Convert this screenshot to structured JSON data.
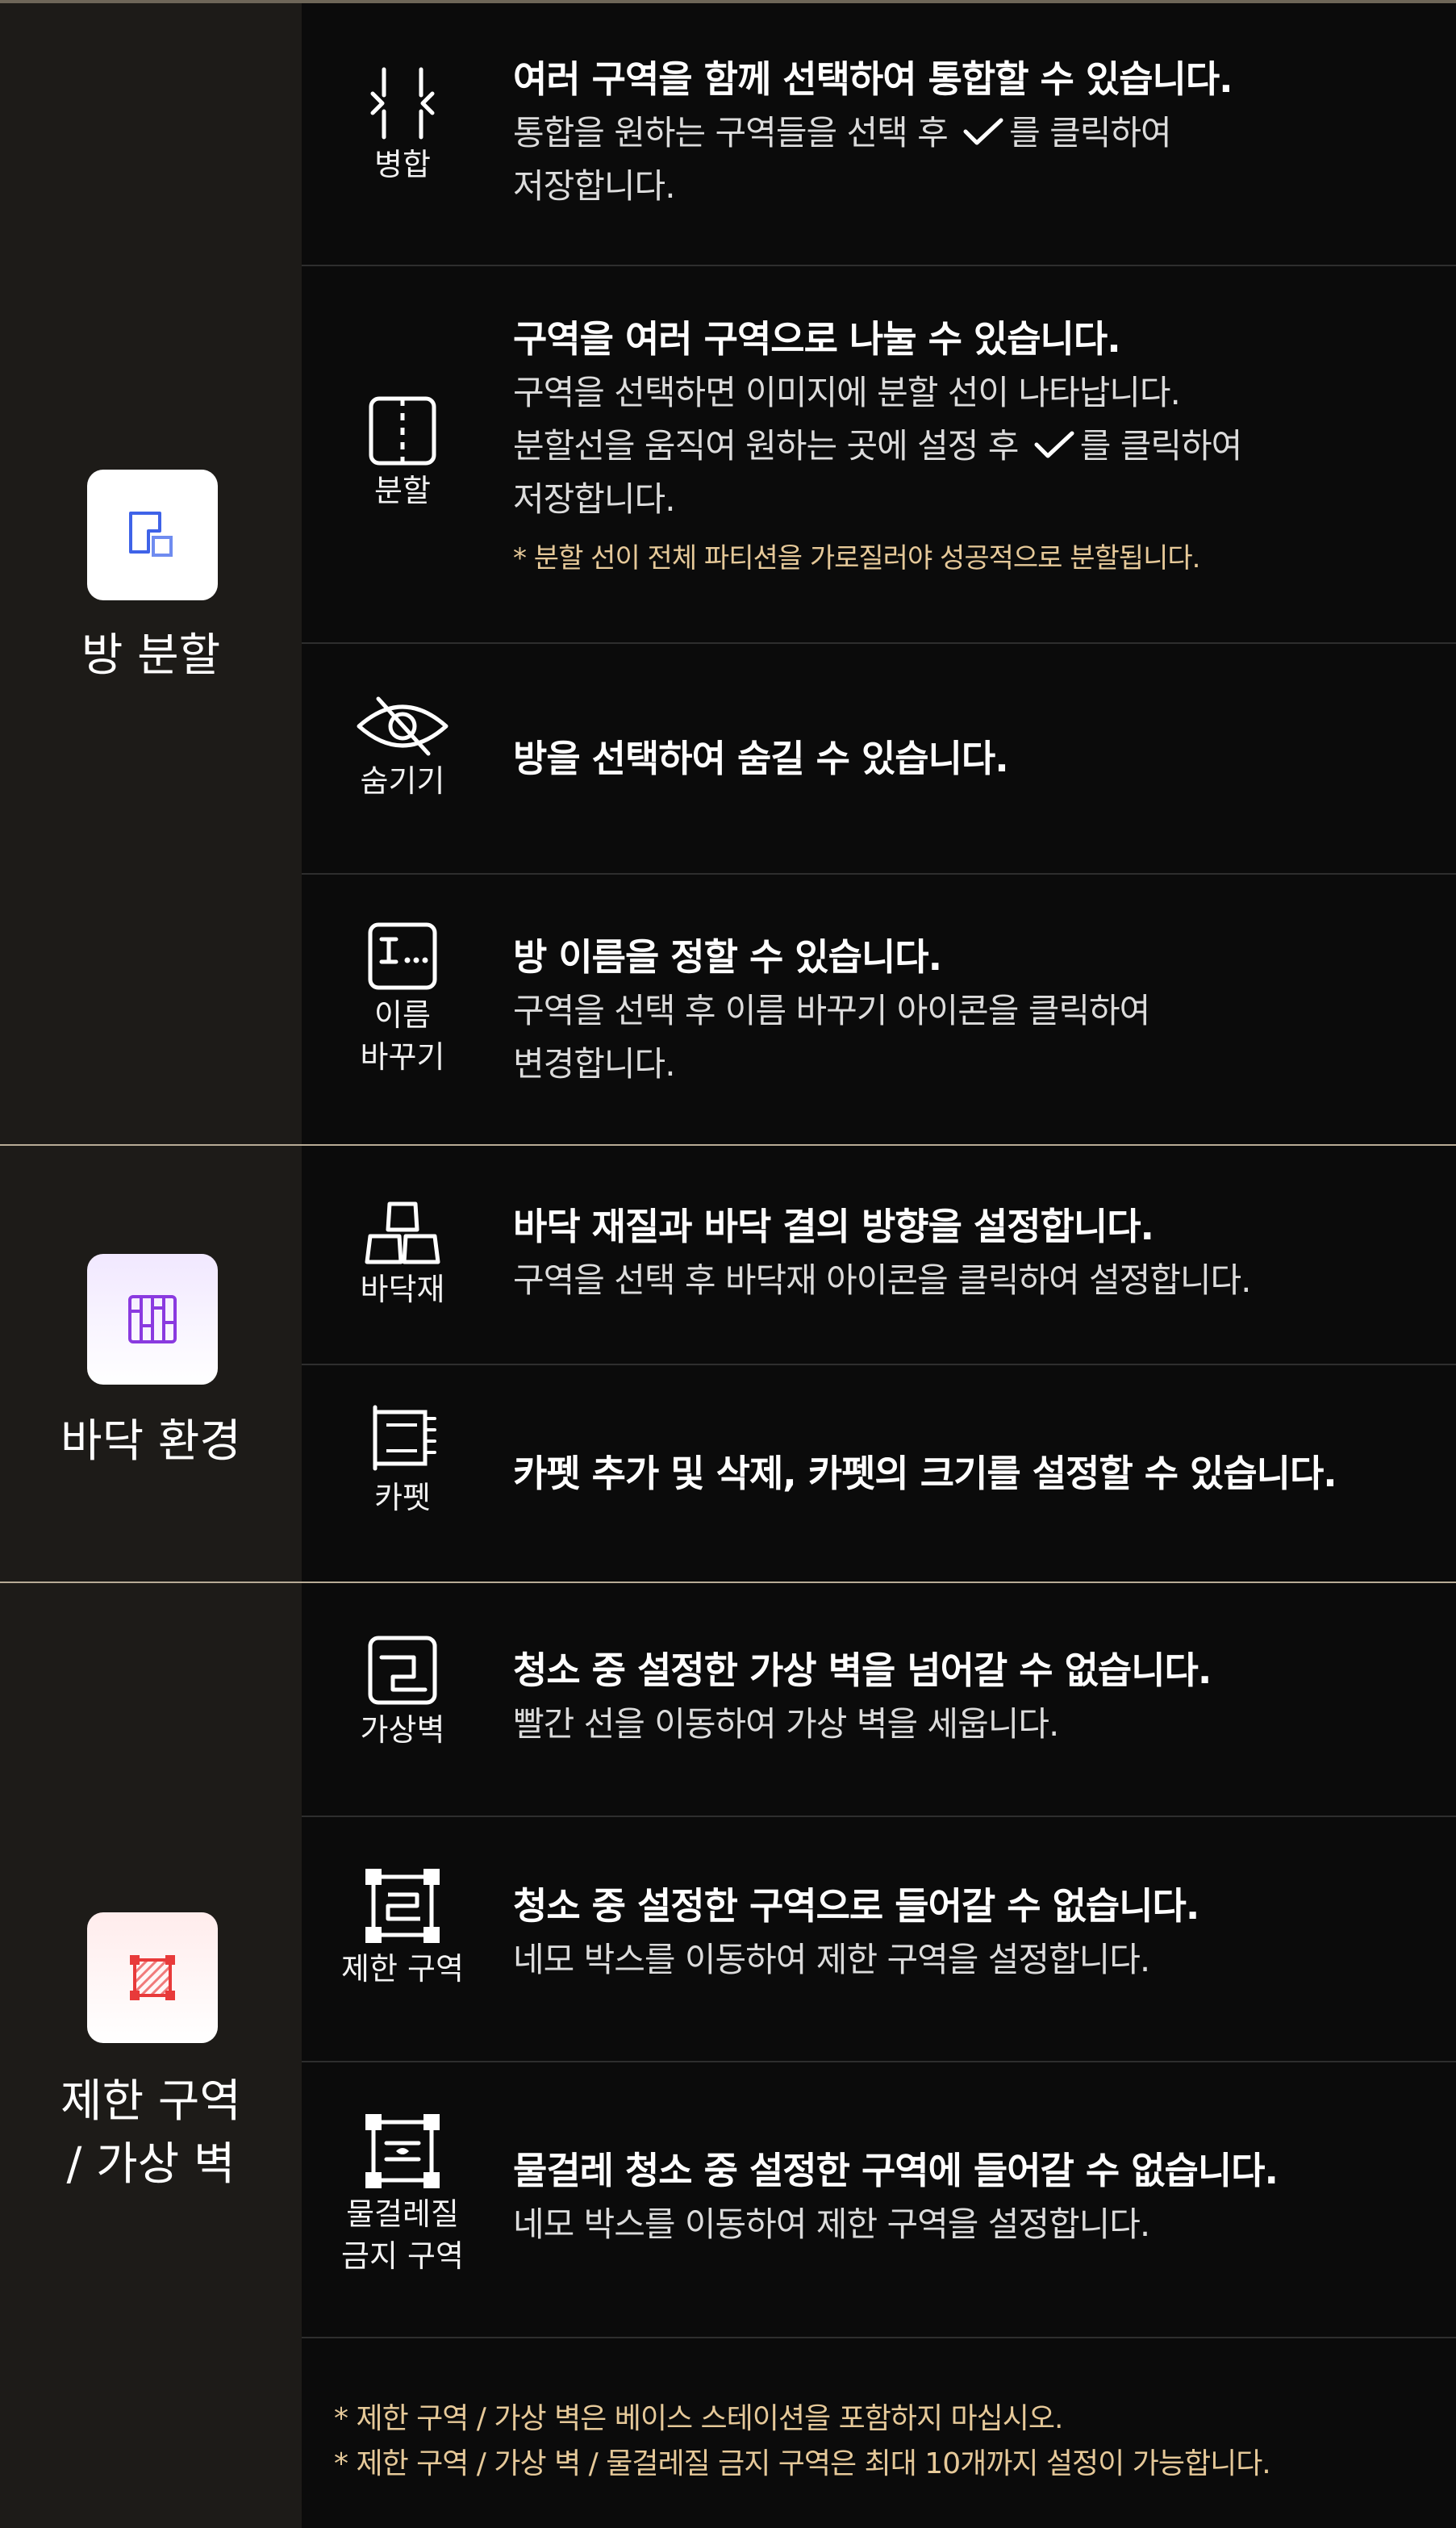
{
  "colors": {
    "background": "#0b0b0b",
    "sidebar": "#1d1b18",
    "note": "#e6c999",
    "icon_blue": "#3f63e8",
    "icon_purple": "#8a3ae0",
    "icon_red": "#e83a3a"
  },
  "sections": [
    {
      "category": "방 분할",
      "icon": "room-split-icon",
      "rows": [
        {
          "tool_label": "병합",
          "tool_icon": "merge-icon",
          "title": "여러 구역을 함께 선택하여 통합할 수 있습니다.",
          "body_before_check": "통합을 원하는 구역들을 선택 후 ",
          "body_after_check": "를 클릭하여\n저장합니다."
        },
        {
          "tool_label": "분할",
          "tool_icon": "split-icon",
          "title": "구역을 여러 구역으로 나눌 수 있습니다.",
          "body_before_check": "구역을 선택하면 이미지에 분할 선이 나타납니다.\n분할선을 움직여 원하는 곳에 설정 후 ",
          "body_after_check": "를 클릭하여\n저장합니다.",
          "note": "* 분할 선이 전체 파티션을 가로질러야 성공적으로 분할됩니다."
        },
        {
          "tool_label": "숨기기",
          "tool_icon": "eye-off-icon",
          "title": "방을 선택하여 숨길 수 있습니다."
        },
        {
          "tool_label": "이름\n바꾸기",
          "tool_icon": "rename-icon",
          "title": "방 이름을 정할 수 있습니다.",
          "body": "구역을 선택 후 이름 바꾸기 아이콘을 클릭하여\n변경합니다."
        }
      ]
    },
    {
      "category": "바닥 환경",
      "icon": "floor-icon",
      "rows": [
        {
          "tool_label": "바닥재",
          "tool_icon": "floor-material-icon",
          "title": "바닥 재질과 바닥 결의 방향을 설정합니다.",
          "body": "구역을 선택 후 바닥재 아이콘을 클릭하여 설정합니다."
        },
        {
          "tool_label": "카펫",
          "tool_icon": "carpet-icon",
          "title": "카펫 추가 및 삭제, 카펫의 크기를 설정할 수 있습니다."
        }
      ]
    },
    {
      "category": "제한 구역\n/ 가상 벽",
      "icon": "restricted-zone-icon",
      "rows": [
        {
          "tool_label": "가상벽",
          "tool_icon": "virtual-wall-icon",
          "title": "청소 중 설정한 가상 벽을 넘어갈 수 없습니다.",
          "body": "빨간 선을 이동하여 가상 벽을 세웁니다."
        },
        {
          "tool_label": "제한 구역",
          "tool_icon": "no-go-zone-icon",
          "title": "청소 중 설정한 구역으로 들어갈 수 없습니다.",
          "body": "네모 박스를 이동하여 제한 구역을 설정합니다."
        },
        {
          "tool_label": "물걸레질\n금지 구역",
          "tool_icon": "no-mop-zone-icon",
          "title": "물걸레 청소 중 설정한 구역에 들어갈 수 없습니다.",
          "body": "네모 박스를 이동하여 제한 구역을 설정합니다."
        }
      ]
    }
  ],
  "footer_notes": [
    "* 제한 구역 / 가상 벽은 베이스 스테이션을 포함하지 마십시오.",
    "* 제한 구역 / 가상 벽 / 물걸레질 금지 구역은 최대 10개까지 설정이 가능합니다."
  ]
}
